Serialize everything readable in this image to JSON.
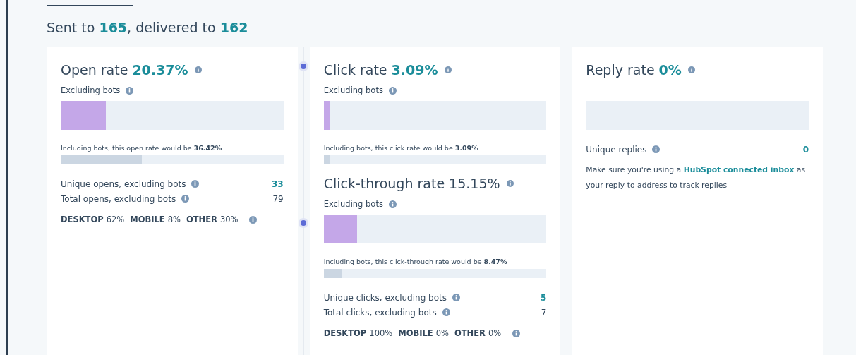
{
  "headline": "Sent to **165**, delivered to **162**",
  "cards": [
    {
      "sections": [
        {
          "title": "Open rate",
          "value": "20.37%",
          "value_highlight": true,
          "bar_label": "Excluding bots",
          "level": 0.2037,
          "bots": {
            "text": "Including bots, this open rate would be **36.42%**",
            "level": 0.3642
          }
        }
      ],
      "stats": [
        {
          "label": "Unique opens, excluding bots",
          "value": "33",
          "highlight": true
        },
        {
          "label": "Total opens, excluding bots",
          "value": "79",
          "highlight": false
        }
      ],
      "devices": [
        {
          "name": "DESKTOP",
          "value": "62%"
        },
        {
          "name": "MOBILE",
          "value": "8%"
        },
        {
          "name": "OTHER",
          "value": "30%"
        }
      ]
    },
    {
      "sections": [
        {
          "title": "Click rate",
          "value": "3.09%",
          "value_highlight": true,
          "bar_label": "Excluding bots",
          "level": 0.0309,
          "bots": {
            "text": "Including bots, this click rate would be **3.09%**",
            "level": 0.0309
          }
        },
        {
          "title": "Click-through rate",
          "value": "15.15%",
          "value_highlight": false,
          "bar_label": "Excluding bots",
          "level": 0.1515,
          "bots": {
            "text": "Including bots, this click-through rate would be **8.47%**",
            "level": 0.0847
          }
        }
      ],
      "stats": [
        {
          "label": "Unique clicks, excluding bots",
          "value": "5",
          "highlight": true
        },
        {
          "label": "Total clicks, excluding bots",
          "value": "7",
          "highlight": false
        }
      ],
      "devices": [
        {
          "name": "DESKTOP",
          "value": "100%"
        },
        {
          "name": "MOBILE",
          "value": "0%"
        },
        {
          "name": "OTHER",
          "value": "0%"
        }
      ]
    },
    {
      "sections": [
        {
          "title": "Reply rate",
          "value": "0%",
          "value_highlight": true
        }
      ],
      "stats": [
        {
          "label": "Unique replies",
          "value": "0",
          "highlight": true
        }
      ],
      "note": {
        "before": "Make sure you're using a ",
        "link": "HubSpot connected inbox",
        "after": " as your reply-to address to track replies"
      }
    }
  ]
}
